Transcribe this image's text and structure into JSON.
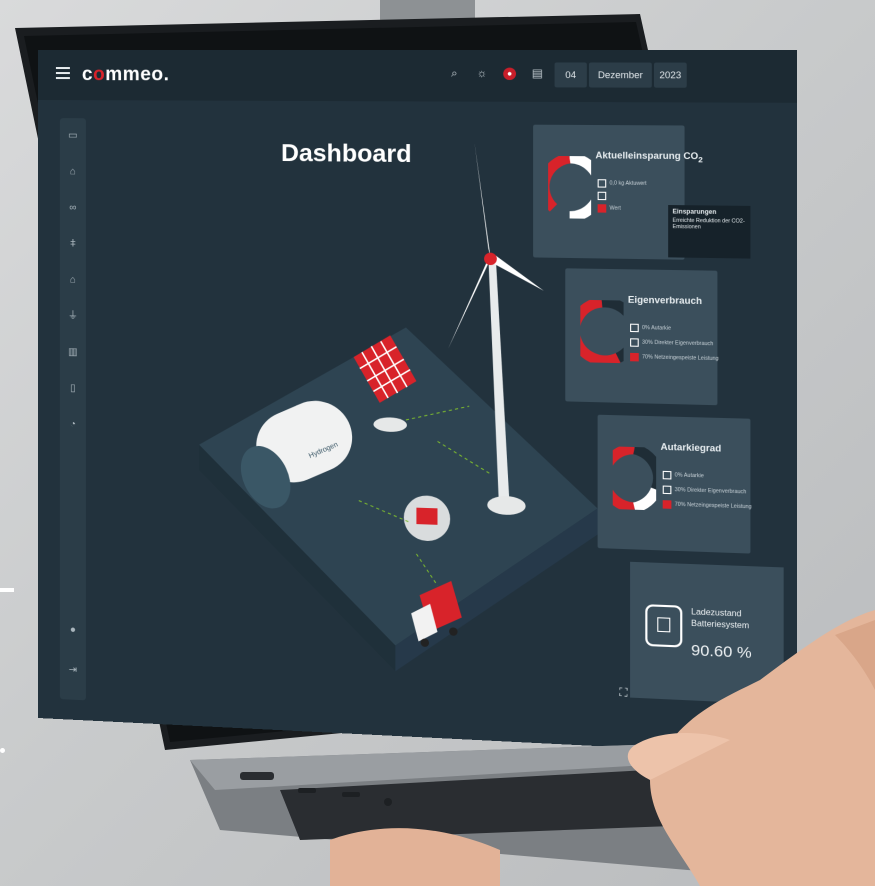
{
  "app": {
    "logo": {
      "prefix": "c",
      "accent": "o",
      "rest": "mmeo."
    },
    "title": "Dashboard"
  },
  "topbar": {
    "icons": [
      "search-icon",
      "sun-icon",
      "flag-icon",
      "calendar-icon"
    ],
    "date": {
      "day": "04",
      "month": "Dezember",
      "year": "2023"
    }
  },
  "sidebar": {
    "icons": [
      "monitor-icon",
      "house-icon",
      "link-icon",
      "tower-icon",
      "home-icon",
      "plug-icon",
      "chart-icon",
      "tablet-icon",
      "gauge-icon",
      "bell-icon",
      "logout-icon"
    ]
  },
  "cards": [
    {
      "title": "Aktuelleinsparung CO",
      "subscript": "2",
      "rows": [
        "0,0 kg Aktuwert",
        "",
        "Wert"
      ],
      "donut": {
        "red": 0.45,
        "white": 0.25,
        "dark": 0.3
      }
    },
    {
      "title": "Eigenverbrauch",
      "rows": [
        "0% Autarkie",
        "30% Direkter Eigenverbrauch",
        "70% Netzeingespeiste Leistung"
      ],
      "donut": {
        "red": 0.35,
        "white": 0.0,
        "dark": 0.65
      }
    },
    {
      "title": "Autarkiegrad",
      "rows": [
        "0% Autarkie",
        "30% Direkter Eigenverbrauch",
        "70% Netzeingespeiste Leistung"
      ],
      "donut": {
        "red": 0.4,
        "white": 0.25,
        "dark": 0.35
      }
    }
  ],
  "tooltip": {
    "title": "Einsparungen",
    "body": "Erreichte Reduktion der CO2-Emissionen"
  },
  "battery": {
    "label_line1": "Ladezustand",
    "label_line2": "Batteriesystem",
    "value": "90.60 %"
  },
  "scene": {
    "tank_label": "Hydrogen"
  },
  "colors": {
    "accent": "#d8232a",
    "background": "#22323d",
    "card": "#3b4f5c"
  }
}
